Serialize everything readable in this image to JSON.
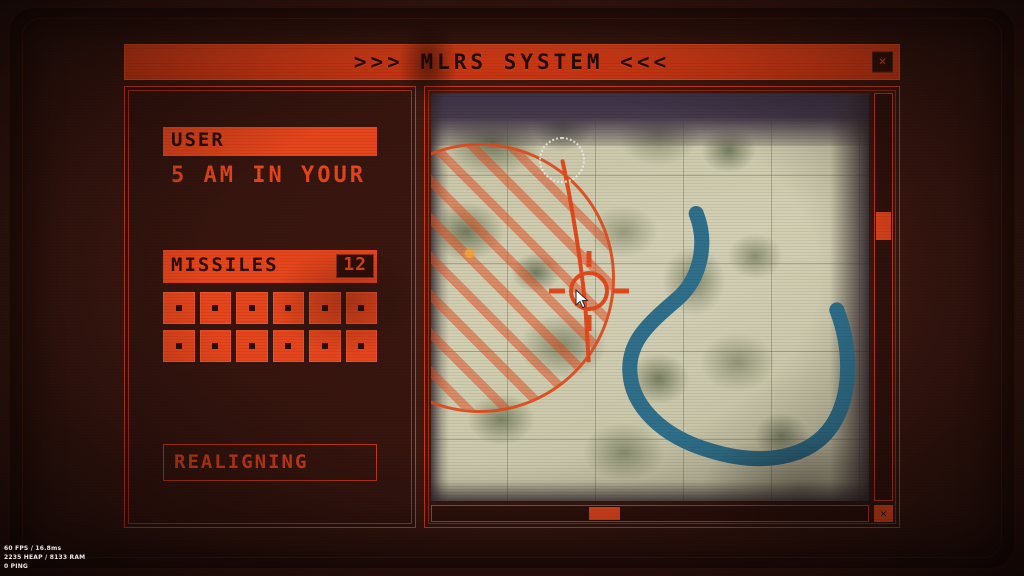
{
  "window": {
    "title": ">>> MLRS SYSTEM <<<",
    "close_label": "×",
    "close_icon": "close-icon"
  },
  "left_panel": {
    "user": {
      "header": "USER",
      "value": "5 AM IN YOUR"
    },
    "missiles": {
      "header": "MISSILES",
      "count": "12",
      "slots": [
        {
          "state": "loaded"
        },
        {
          "state": "loaded"
        },
        {
          "state": "loaded"
        },
        {
          "state": "loaded"
        },
        {
          "state": "loaded"
        },
        {
          "state": "loaded"
        },
        {
          "state": "loaded"
        },
        {
          "state": "loaded"
        },
        {
          "state": "loaded"
        },
        {
          "state": "loaded"
        },
        {
          "state": "loaded"
        },
        {
          "state": "loaded"
        }
      ]
    },
    "status": {
      "text": "REALIGNING"
    }
  },
  "map_panel": {
    "range_zone_label": "firing-range-zone",
    "target_label": "target-crosshair",
    "launcher_label": "launcher-marker",
    "destination_label": "impact-point",
    "vscroll_label": "vertical-scrollbar",
    "hscroll_label": "horizontal-scrollbar",
    "corner_label": "×"
  },
  "debug_hud": {
    "line1": "60 FPS / 16.8ms",
    "line2": "2235 HEAP / 8133 RAM",
    "line3": "0 PING"
  },
  "colors": {
    "accent": "#e5451c",
    "accent_bright": "#e8481d",
    "accent_dim": "#cf3e18",
    "panel_bg": "#30120c",
    "text_dark": "#2c0e06",
    "terrain": "#cdc9ae",
    "water": "#2f6f8a",
    "marker": "#f3a23a"
  }
}
